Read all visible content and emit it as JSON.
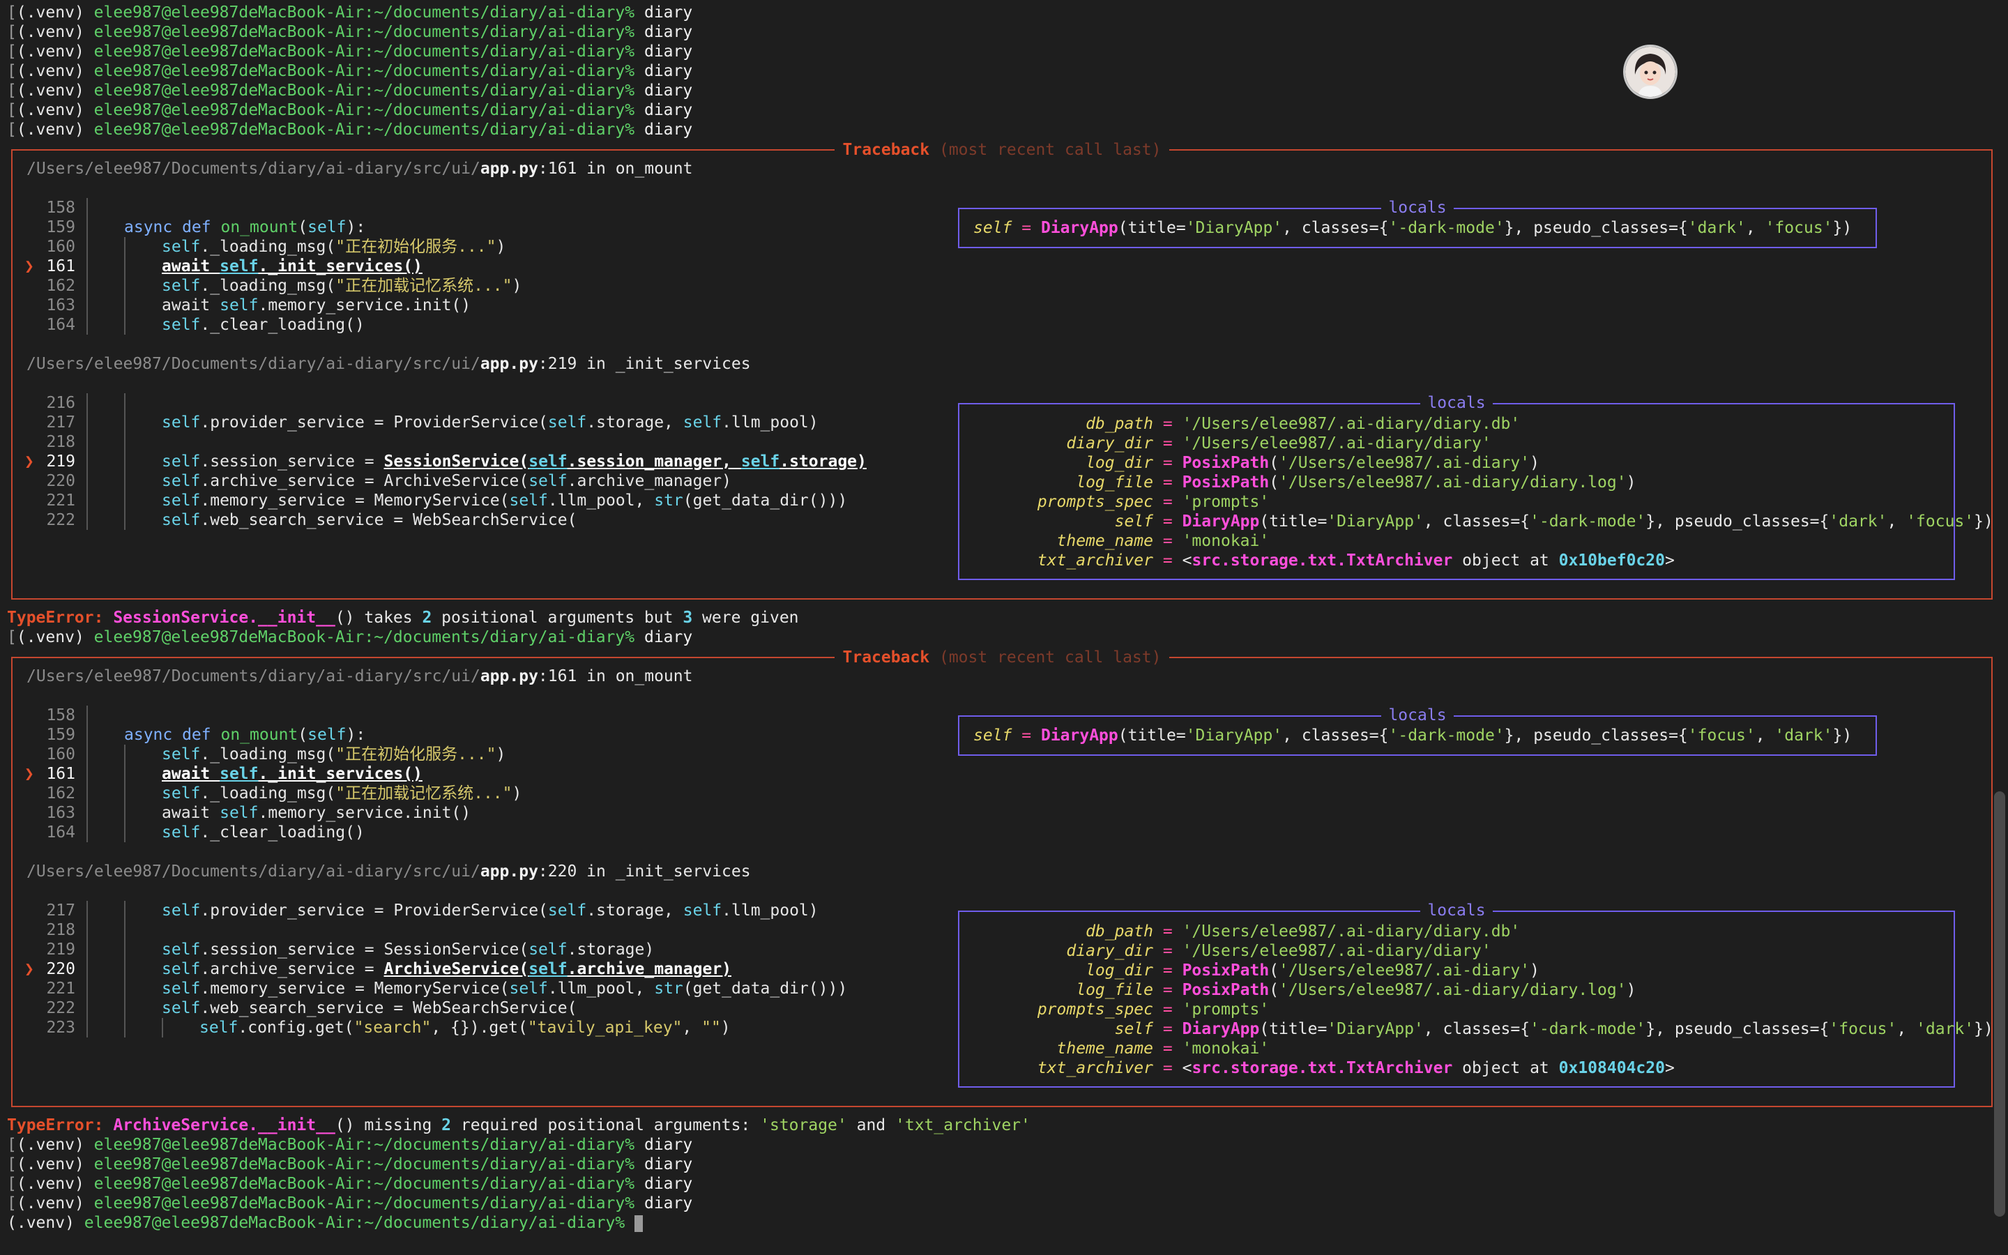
{
  "prompt": {
    "env": "(.venv)",
    "user_host": "elee987@elee987deMacBook-Air:~/documents/diary/ai-diary%",
    "command": "diary"
  },
  "traceback_title": "Traceback",
  "traceback_subtitle": "(most recent call last)",
  "locals_title": "locals",
  "tb1": {
    "frame1": {
      "path_dir": "/Users/elee987/Documents/diary/ai-diary/src/ui/",
      "path_file": "app.py",
      "path_tail": ":161 in on_mount",
      "line_numbers": [
        "158",
        "159",
        "160",
        "161",
        "162",
        "163",
        "164"
      ],
      "code": [
        "",
        "async def on_mount(self):",
        "self._loading_msg(\"正在初始化服务...\")",
        "await self._init_services()",
        "self._loading_msg(\"正在加载记忆系统...\")",
        "await self.memory_service.init()",
        "self._clear_loading()"
      ],
      "locals_self": "DiaryApp(title='DiaryApp', classes={'-dark-mode'}, pseudo_classes={'dark', 'focus'})"
    },
    "frame2": {
      "path_dir": "/Users/elee987/Documents/diary/ai-diary/src/ui/",
      "path_file": "app.py",
      "path_tail": ":219 in _init_services",
      "line_numbers": [
        "216",
        "217",
        "218",
        "219",
        "220",
        "221",
        "222"
      ],
      "code": [
        "",
        "self.provider_service = ProviderService(self.storage, self.llm_pool)",
        "",
        "self.session_service = SessionService(self.session_manager, self.storage)",
        "self.archive_service = ArchiveService(self.archive_manager)",
        "self.memory_service = MemoryService(self.llm_pool, str(get_data_dir()))",
        "self.web_search_service = WebSearchService("
      ],
      "locals": {
        "db_path": "'/Users/elee987/.ai-diary/diary.db'",
        "diary_dir": "'/Users/elee987/.ai-diary/diary'",
        "log_dir": "PosixPath('/Users/elee987/.ai-diary')",
        "log_file": "PosixPath('/Users/elee987/.ai-diary/diary.log')",
        "prompts_spec": "'prompts'",
        "self": "DiaryApp(title='DiaryApp', classes={'-dark-mode'}, pseudo_classes={'dark', 'focus'})",
        "theme_name": "'monokai'",
        "txt_archiver": "<src.storage.txt.TxtArchiver object at 0x10bef0c20>"
      }
    },
    "error": "TypeError: SessionService.__init__() takes 2 positional arguments but 3 were given"
  },
  "tb2": {
    "frame1": {
      "path_tail": ":161 in on_mount",
      "locals_self": "DiaryApp(title='DiaryApp', classes={'-dark-mode'}, pseudo_classes={'focus', 'dark'})"
    },
    "frame2": {
      "path_tail": ":220 in _init_services",
      "line_numbers": [
        "217",
        "218",
        "219",
        "220",
        "221",
        "222",
        "223"
      ],
      "code": [
        "self.provider_service = ProviderService(self.storage, self.llm_pool)",
        "",
        "self.session_service = SessionService(self.storage)",
        "self.archive_service = ArchiveService(self.archive_manager)",
        "self.memory_service = MemoryService(self.llm_pool, str(get_data_dir()))",
        "self.web_search_service = WebSearchService(",
        "self.config.get(\"search\", {}).get(\"tavily_api_key\", \"\")"
      ],
      "locals": {
        "self": "DiaryApp(title='DiaryApp', classes={'-dark-mode'}, pseudo_classes={'focus', 'dark'})",
        "txt_archiver": "<src.storage.txt.TxtArchiver object at 0x108404c20>"
      }
    },
    "error": "TypeError: ArchiveService.__init__() missing 2 required positional arguments: 'storage' and 'txt_archiver'"
  }
}
